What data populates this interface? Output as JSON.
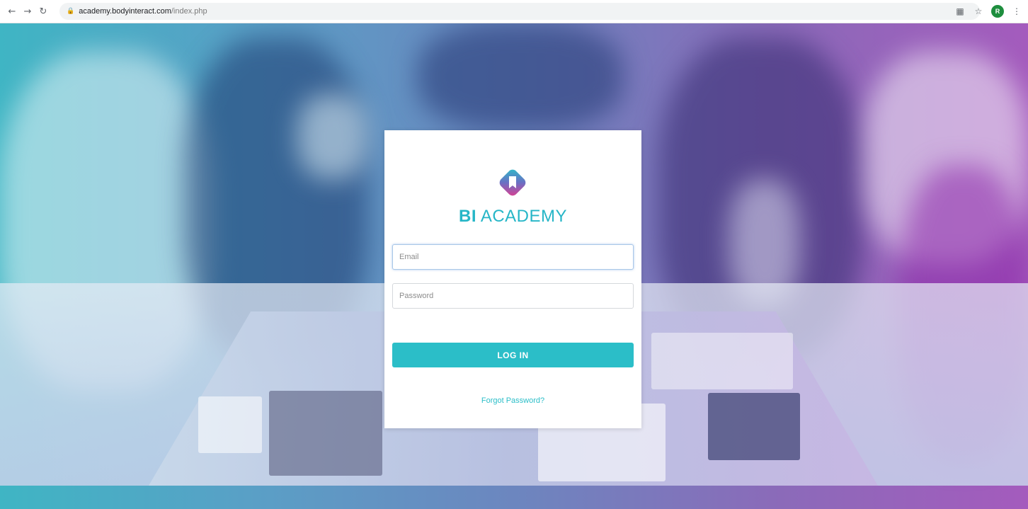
{
  "browser": {
    "back_icon": "back-arrow-icon",
    "forward_icon": "forward-arrow-icon",
    "reload_icon": "reload-icon",
    "lock_icon": "lock-icon",
    "url_host": "academy.bodyinteract.com",
    "url_path": "/index.php",
    "avatar_initial": "R",
    "avatar_color": "#1e8e3e"
  },
  "login": {
    "brand_bold": "BI",
    "brand_rest": " ACADEMY",
    "email_placeholder": "Email",
    "password_placeholder": "Password",
    "login_label": "LOG IN",
    "forgot_label": "Forgot Password?",
    "accent_color": "#2bbec8"
  }
}
